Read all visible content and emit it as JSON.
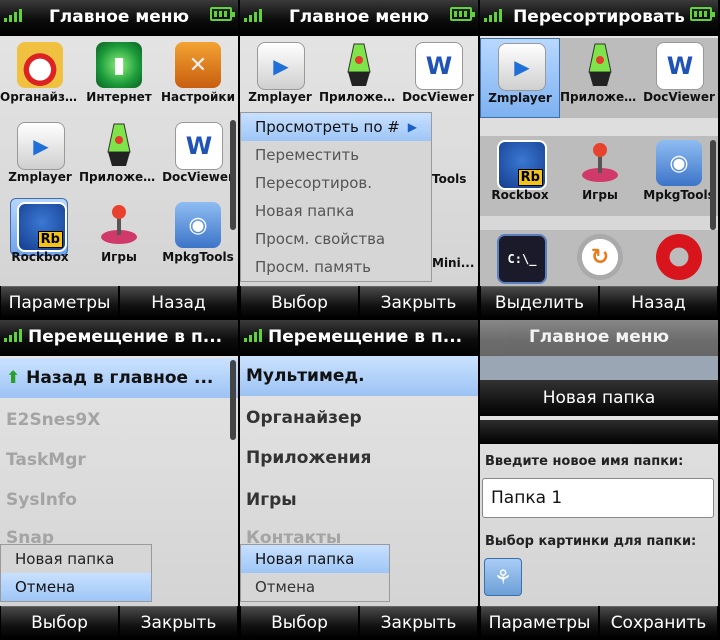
{
  "colors": {
    "signal": "#5fd23d",
    "highlight": "#9cc3f4",
    "titlebar": "#000000"
  },
  "screen1": {
    "title": "Главное меню",
    "icons": [
      {
        "label": "Органайзер",
        "icon": "organizer-clock-icon"
      },
      {
        "label": "Интернет",
        "icon": "internet-globe-icon"
      },
      {
        "label": "Настройки",
        "icon": "settings-wrench-icon"
      },
      {
        "label": "Zmplayer",
        "icon": "zmplayer-icon"
      },
      {
        "label": "Приложен...",
        "icon": "lava-lamp-icon"
      },
      {
        "label": "DocViewer",
        "icon": "word-doc-icon"
      },
      {
        "label": "Rockbox",
        "icon": "rockbox-icon"
      },
      {
        "label": "Игры",
        "icon": "joystick-icon"
      },
      {
        "label": "MpkgTools",
        "icon": "package-disc-icon"
      }
    ],
    "soft_left": "Параметры",
    "soft_right": "Назад"
  },
  "screen2": {
    "title": "Главное меню",
    "icons": [
      {
        "label": "Zmplayer"
      },
      {
        "label": "Приложен..."
      },
      {
        "label": "DocViewer"
      }
    ],
    "partial_labels": [
      "Tools",
      "Mini..."
    ],
    "menu": [
      "Просмотреть по #",
      "Переместить",
      "Пересортиров.",
      "Новая папка",
      "Просм. свойства",
      "Просм. память"
    ],
    "soft_left": "Выбор",
    "soft_right": "Закрыть"
  },
  "screen3": {
    "title": "Пересортировать",
    "icons": [
      {
        "label": "Zmplayer"
      },
      {
        "label": "Приложения"
      },
      {
        "label": "DocViewer"
      },
      {
        "label": "Rockbox"
      },
      {
        "label": "Игры"
      },
      {
        "label": "MpkgTools"
      },
      {
        "label": ""
      },
      {
        "label": ""
      },
      {
        "label": ""
      }
    ],
    "soft_left": "Выделить",
    "soft_right": "Назад"
  },
  "screen4": {
    "title": "Перемещение в п...",
    "items": [
      "Назад в главное ...",
      "E2Snes9X",
      "TaskMgr",
      "SysInfo",
      "Snap"
    ],
    "popup": [
      "Новая папка",
      "Отмена"
    ],
    "soft_left": "Выбор",
    "soft_right": "Закрыть"
  },
  "screen5": {
    "title": "Перемещение в п...",
    "items": [
      "Мультимед.",
      "Органайзер",
      "Приложения",
      "Игры",
      "Контакты"
    ],
    "popup": [
      "Новая папка",
      "Отмена"
    ],
    "soft_left": "Выбор",
    "soft_right": "Закрыть"
  },
  "screen6": {
    "title": "Главное меню",
    "dialog_title": "Новая папка",
    "name_label": "Введите новое имя папки:",
    "name_value": "Папка 1",
    "picture_label": "Выбор картинки для папки:",
    "soft_left": "Параметры",
    "soft_right": "Сохранить"
  }
}
